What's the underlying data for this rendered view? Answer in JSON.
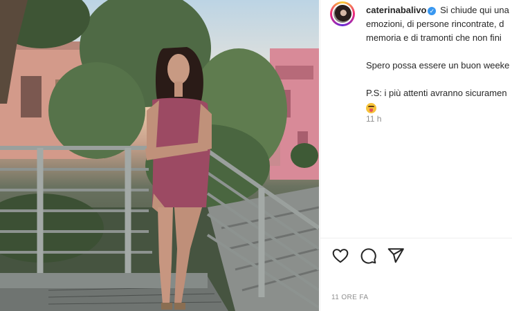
{
  "post": {
    "username": "caterinabalivo",
    "verified_badge": "✓",
    "caption_lines": {
      "line1": "Si chiude qui una",
      "line2": "emozioni, di persone rincontrate, d",
      "line3": "memoria e di tramonti che non fini",
      "line4": "Spero possa essere un buon weeke",
      "line5": "P.S: i più attenti avranno sicuramen"
    },
    "emoji": "tongue-out-face",
    "age_short": "11 h",
    "age_long": "11 ORE FA"
  },
  "icons": {
    "like": "heart-icon",
    "comment": "comment-icon",
    "share": "send-icon"
  },
  "colors": {
    "verified": "#3897f0",
    "muted_text": "#8e8e8e",
    "divider": "#efefef"
  }
}
